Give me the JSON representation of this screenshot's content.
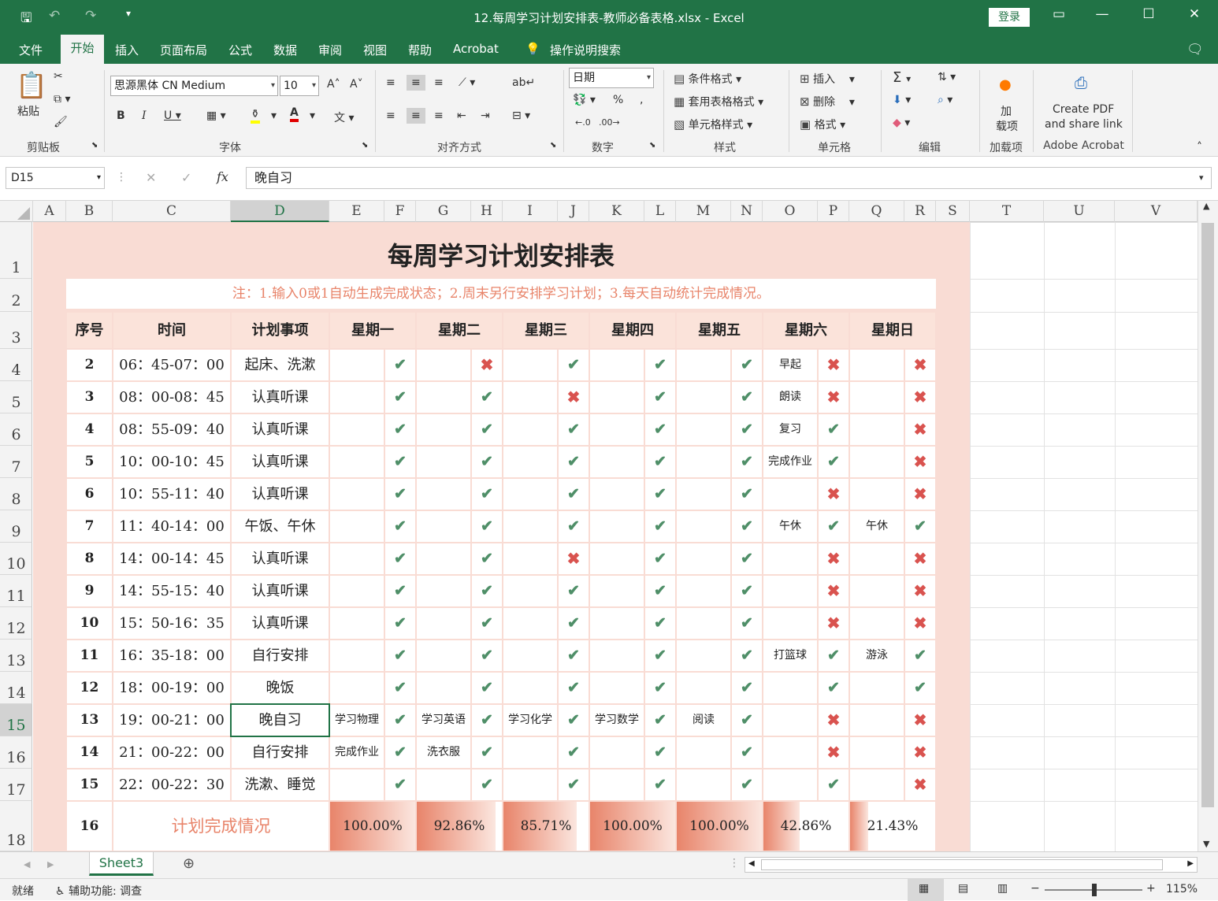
{
  "window": {
    "title": "12.每周学习计划安排表-教师必备表格.xlsx  -  Excel",
    "login": "登录"
  },
  "tabs": [
    "文件",
    "开始",
    "插入",
    "页面布局",
    "公式",
    "数据",
    "审阅",
    "视图",
    "帮助",
    "Acrobat"
  ],
  "tell_me": "操作说明搜索",
  "ribbon": {
    "paste": "粘贴",
    "clipboard": "剪贴板",
    "font_name": "思源黑体 CN Medium",
    "font_size": "10",
    "font_group": "字体",
    "align_group": "对齐方式",
    "number_format": "日期",
    "number_group": "数字",
    "cond_format": "条件格式",
    "table_format": "套用表格格式",
    "cell_style": "单元格样式",
    "styles_group": "样式",
    "insert": "插入",
    "delete": "删除",
    "format": "格式",
    "cells_group": "单元格",
    "edit_group": "编辑",
    "addin_1": "加",
    "addin_2": "载项",
    "addin_group": "加载项",
    "pdf_1": "Create PDF",
    "pdf_2": "and share link",
    "acrobat_group": "Adobe Acrobat"
  },
  "formula_bar": {
    "cell_ref": "D15",
    "content": "晚自习"
  },
  "columns": [
    "A",
    "B",
    "C",
    "D",
    "E",
    "F",
    "G",
    "H",
    "I",
    "J",
    "K",
    "L",
    "M",
    "N",
    "O",
    "P",
    "Q",
    "R",
    "S",
    "T",
    "U",
    "V"
  ],
  "selected_column": "D",
  "selected_row": "15",
  "row_numbers": [
    "1",
    "2",
    "3",
    "4",
    "5",
    "6",
    "7",
    "8",
    "9",
    "10",
    "11",
    "12",
    "13",
    "14",
    "15",
    "16",
    "17",
    "18"
  ],
  "sheet": {
    "title": "每周学习计划安排表",
    "note": "注：1.输入0或1自动生成完成状态；2.周末另行安排学习计划；3.每天自动统计完成情况。",
    "headers": [
      "序号",
      "时间",
      "计划事项",
      "星期一",
      "星期二",
      "星期三",
      "星期四",
      "星期五",
      "星期六",
      "星期日"
    ],
    "rows": [
      {
        "no": "2",
        "time": "06：45-07：00",
        "item": "起床、洗漱",
        "days": [
          [
            "",
            "ok"
          ],
          [
            "",
            "no"
          ],
          [
            "",
            "ok"
          ],
          [
            "",
            "ok"
          ],
          [
            "",
            "ok"
          ],
          [
            "早起",
            "no"
          ],
          [
            "",
            "no"
          ]
        ]
      },
      {
        "no": "3",
        "time": "08：00-08：45",
        "item": "认真听课",
        "days": [
          [
            "",
            "ok"
          ],
          [
            "",
            "ok"
          ],
          [
            "",
            "no"
          ],
          [
            "",
            "ok"
          ],
          [
            "",
            "ok"
          ],
          [
            "朗读",
            "no"
          ],
          [
            "",
            "no"
          ]
        ]
      },
      {
        "no": "4",
        "time": "08：55-09：40",
        "item": "认真听课",
        "days": [
          [
            "",
            "ok"
          ],
          [
            "",
            "ok"
          ],
          [
            "",
            "ok"
          ],
          [
            "",
            "ok"
          ],
          [
            "",
            "ok"
          ],
          [
            "复习",
            "ok"
          ],
          [
            "",
            "no"
          ]
        ]
      },
      {
        "no": "5",
        "time": "10：00-10：45",
        "item": "认真听课",
        "days": [
          [
            "",
            "ok"
          ],
          [
            "",
            "ok"
          ],
          [
            "",
            "ok"
          ],
          [
            "",
            "ok"
          ],
          [
            "",
            "ok"
          ],
          [
            "完成作业",
            "ok"
          ],
          [
            "",
            "no"
          ]
        ]
      },
      {
        "no": "6",
        "time": "10：55-11：40",
        "item": "认真听课",
        "days": [
          [
            "",
            "ok"
          ],
          [
            "",
            "ok"
          ],
          [
            "",
            "ok"
          ],
          [
            "",
            "ok"
          ],
          [
            "",
            "ok"
          ],
          [
            "",
            "no"
          ],
          [
            "",
            "no"
          ]
        ]
      },
      {
        "no": "7",
        "time": "11：40-14：00",
        "item": "午饭、午休",
        "days": [
          [
            "",
            "ok"
          ],
          [
            "",
            "ok"
          ],
          [
            "",
            "ok"
          ],
          [
            "",
            "ok"
          ],
          [
            "",
            "ok"
          ],
          [
            "午休",
            "ok"
          ],
          [
            "午休",
            "ok"
          ]
        ]
      },
      {
        "no": "8",
        "time": "14：00-14：45",
        "item": "认真听课",
        "days": [
          [
            "",
            "ok"
          ],
          [
            "",
            "ok"
          ],
          [
            "",
            "no"
          ],
          [
            "",
            "ok"
          ],
          [
            "",
            "ok"
          ],
          [
            "",
            "no"
          ],
          [
            "",
            "no"
          ]
        ]
      },
      {
        "no": "9",
        "time": "14：55-15：40",
        "item": "认真听课",
        "days": [
          [
            "",
            "ok"
          ],
          [
            "",
            "ok"
          ],
          [
            "",
            "ok"
          ],
          [
            "",
            "ok"
          ],
          [
            "",
            "ok"
          ],
          [
            "",
            "no"
          ],
          [
            "",
            "no"
          ]
        ]
      },
      {
        "no": "10",
        "time": "15：50-16：35",
        "item": "认真听课",
        "days": [
          [
            "",
            "ok"
          ],
          [
            "",
            "ok"
          ],
          [
            "",
            "ok"
          ],
          [
            "",
            "ok"
          ],
          [
            "",
            "ok"
          ],
          [
            "",
            "no"
          ],
          [
            "",
            "no"
          ]
        ]
      },
      {
        "no": "11",
        "time": "16：35-18：00",
        "item": "自行安排",
        "days": [
          [
            "",
            "ok"
          ],
          [
            "",
            "ok"
          ],
          [
            "",
            "ok"
          ],
          [
            "",
            "ok"
          ],
          [
            "",
            "ok"
          ],
          [
            "打篮球",
            "ok"
          ],
          [
            "游泳",
            "ok"
          ]
        ]
      },
      {
        "no": "12",
        "time": "18：00-19：00",
        "item": "晚饭",
        "days": [
          [
            "",
            "ok"
          ],
          [
            "",
            "ok"
          ],
          [
            "",
            "ok"
          ],
          [
            "",
            "ok"
          ],
          [
            "",
            "ok"
          ],
          [
            "",
            "ok"
          ],
          [
            "",
            "ok"
          ]
        ]
      },
      {
        "no": "13",
        "time": "19：00-21：00",
        "item": "晚自习",
        "days": [
          [
            "学习物理",
            "ok"
          ],
          [
            "学习英语",
            "ok"
          ],
          [
            "学习化学",
            "ok"
          ],
          [
            "学习数学",
            "ok"
          ],
          [
            "阅读",
            "ok"
          ],
          [
            "",
            "no"
          ],
          [
            "",
            "no"
          ]
        ]
      },
      {
        "no": "14",
        "time": "21：00-22：00",
        "item": "自行安排",
        "days": [
          [
            "完成作业",
            "ok"
          ],
          [
            "洗衣服",
            "ok"
          ],
          [
            "",
            "ok"
          ],
          [
            "",
            "ok"
          ],
          [
            "",
            "ok"
          ],
          [
            "",
            "no"
          ],
          [
            "",
            "no"
          ]
        ]
      },
      {
        "no": "15",
        "time": "22：00-22：30",
        "item": "洗漱、睡觉",
        "days": [
          [
            "",
            "ok"
          ],
          [
            "",
            "ok"
          ],
          [
            "",
            "ok"
          ],
          [
            "",
            "ok"
          ],
          [
            "",
            "ok"
          ],
          [
            "",
            "ok"
          ],
          [
            "",
            "no"
          ]
        ]
      }
    ],
    "summary": {
      "no": "16",
      "label": "计划完成情况",
      "percents": [
        "100.00%",
        "92.86%",
        "85.71%",
        "100.00%",
        "100.00%",
        "42.86%",
        "21.43%"
      ],
      "fractions": [
        1.0,
        0.9286,
        0.8571,
        1.0,
        1.0,
        0.4286,
        0.2143
      ]
    }
  },
  "sheet_tab": "Sheet3",
  "status": {
    "ready": "就绪",
    "accessibility": "辅助功能: 调查",
    "zoom": "115%"
  },
  "colors": {
    "excel_green": "#217346",
    "pink_bg": "#f9dcd4",
    "check": "#4f8f68",
    "cross": "#d9534f",
    "bar": "#e8846a"
  }
}
